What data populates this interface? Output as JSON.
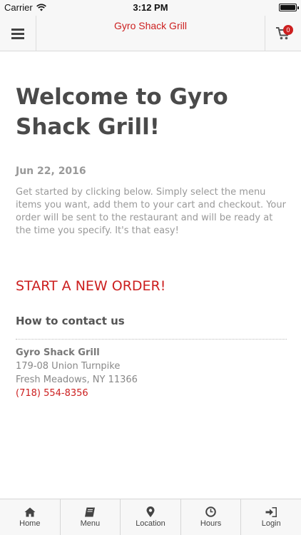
{
  "status_bar": {
    "carrier": "Carrier",
    "time": "3:12 PM"
  },
  "nav": {
    "title": "Gyro Shack Grill",
    "cart_count": "0"
  },
  "content": {
    "title": "Welcome to Gyro Shack Grill!",
    "date": "Jun 22, 2016",
    "intro": "Get started by clicking below. Simply select the menu items you want, add them to your cart and checkout. Your order will be sent to the restaurant and will be ready at the time you specify. It's that easy!",
    "start_order": "START A NEW ORDER!",
    "contact_heading": "How to contact us",
    "restaurant_name": "Gyro Shack Grill",
    "address_line1": "179-08 Union Turnpike",
    "address_line2": "Fresh Meadows, NY 11366",
    "phone": "(718) 554-8356"
  },
  "tabs": [
    {
      "label": "Home",
      "icon": "home-icon"
    },
    {
      "label": "Menu",
      "icon": "book-icon"
    },
    {
      "label": "Location",
      "icon": "map-marker-icon"
    },
    {
      "label": "Hours",
      "icon": "clock-icon"
    },
    {
      "label": "Login",
      "icon": "sign-in-icon"
    }
  ],
  "colors": {
    "accent": "#cc1f1f",
    "bar_bg": "#f7f7f7"
  }
}
